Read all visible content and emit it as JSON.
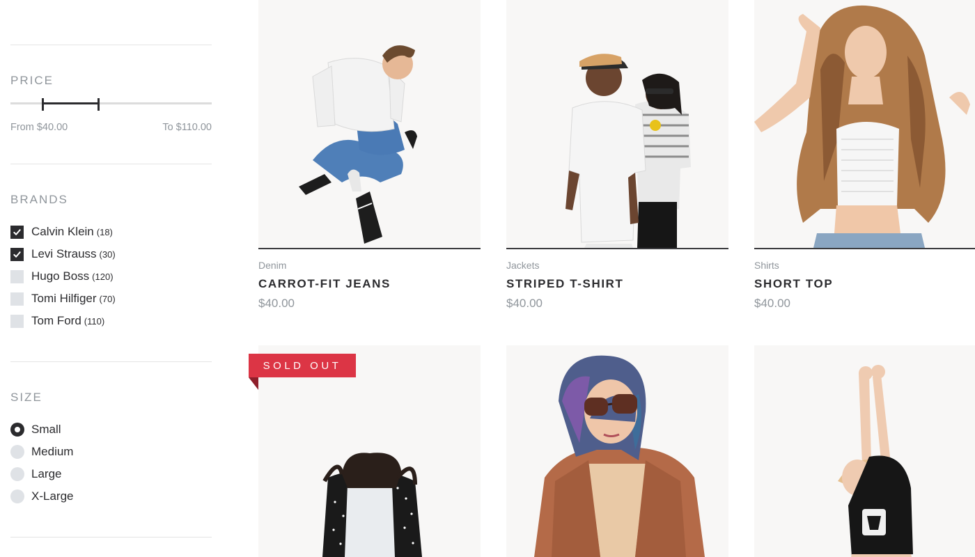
{
  "filters": {
    "price": {
      "title": "PRICE",
      "from_label": "From $40.00",
      "to_label": "To $110.00",
      "range_min_fraction": 0.16,
      "range_max_fraction": 0.44
    },
    "brands": {
      "title": "BRANDS",
      "items": [
        {
          "label": "Calvin Klein",
          "count": "(18)",
          "checked": true
        },
        {
          "label": "Levi Strauss",
          "count": "(30)",
          "checked": true
        },
        {
          "label": "Hugo Boss",
          "count": "(120)",
          "checked": false
        },
        {
          "label": "Tomi Hilfiger",
          "count": "(70)",
          "checked": false
        },
        {
          "label": "Tom Ford",
          "count": "(110)",
          "checked": false
        }
      ]
    },
    "size": {
      "title": "SIZE",
      "items": [
        {
          "label": "Small",
          "selected": true
        },
        {
          "label": "Medium",
          "selected": false
        },
        {
          "label": "Large",
          "selected": false
        },
        {
          "label": "X-Large",
          "selected": false
        }
      ]
    }
  },
  "products": [
    {
      "category": "Denim",
      "name": "CARROT-FIT JEANS",
      "price": "$40.00",
      "image": "man-white-shirt-jeans-sneakers"
    },
    {
      "category": "Jackets",
      "name": "STRIPED T-SHIRT",
      "price": "$40.00",
      "image": "couple-tshirts-caps"
    },
    {
      "category": "Shirts",
      "name": "SHORT TOP",
      "price": "$40.00",
      "image": "woman-curly-hair-crop-top"
    },
    {
      "image": "woman-dark-hair-cardigan",
      "badge": "SOLD OUT"
    },
    {
      "image": "woman-blue-hair-sunglasses-coat"
    },
    {
      "image": "woman-arms-raised-black-tee"
    }
  ],
  "colors": {
    "text": "#2b2b2e",
    "muted": "#8f959b",
    "badge": "#dc3545",
    "control_off": "#dfe2e6"
  }
}
